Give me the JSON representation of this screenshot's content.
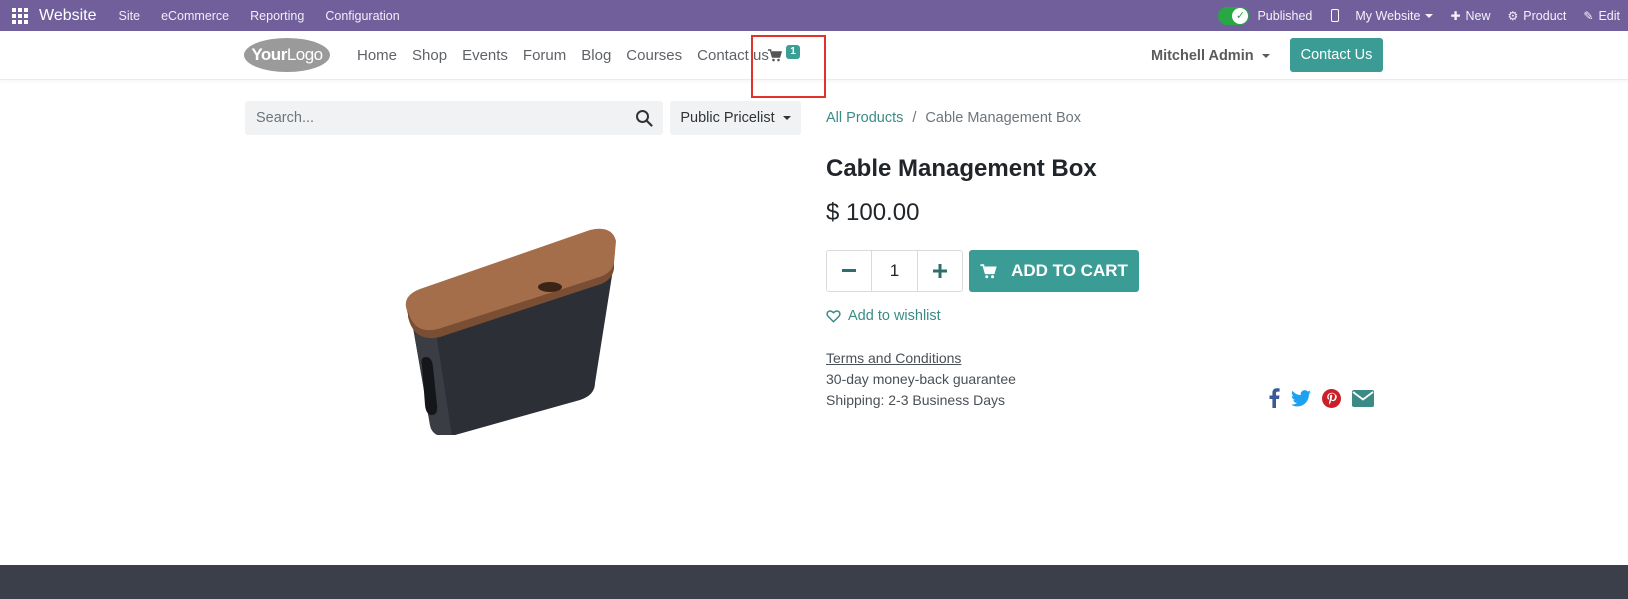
{
  "adminbar": {
    "app_name": "Website",
    "menus": [
      "Site",
      "eCommerce",
      "Reporting",
      "Configuration"
    ],
    "published_label": "Published",
    "website_label": "My Website",
    "new_label": "New",
    "product_label": "Product",
    "edit_label": "Edit"
  },
  "header": {
    "logo_your": "Your",
    "logo_logo": "Logo",
    "nav": [
      "Home",
      "Shop",
      "Events",
      "Forum",
      "Blog",
      "Courses",
      "Contact us"
    ],
    "cart_count": "1",
    "user_name": "Mitchell Admin",
    "contact_button": "Contact Us"
  },
  "shop": {
    "search_placeholder": "Search...",
    "pricelist": "Public Pricelist",
    "breadcrumb_root": "All Products",
    "breadcrumb_sep": "/",
    "breadcrumb_current": "Cable Management Box"
  },
  "product": {
    "name": "Cable Management Box",
    "price": "$ 100.00",
    "quantity": "1",
    "add_to_cart": "ADD TO CART",
    "wishlist": "Add to wishlist",
    "terms": "Terms and Conditions",
    "guarantee": "30-day money-back guarantee",
    "shipping": "Shipping: 2-3 Business Days"
  },
  "icons": {
    "apps": "apps-grid-icon",
    "cart": "shopping-cart-icon",
    "search": "search-icon",
    "heart": "heart-icon",
    "share": [
      "facebook-icon",
      "twitter-icon",
      "pinterest-icon",
      "email-icon"
    ]
  },
  "colors": {
    "admin_bar": "#715f9c",
    "accent": "#3a9c95",
    "highlight_box": "#e0322a",
    "footer": "#3a3f4a"
  }
}
